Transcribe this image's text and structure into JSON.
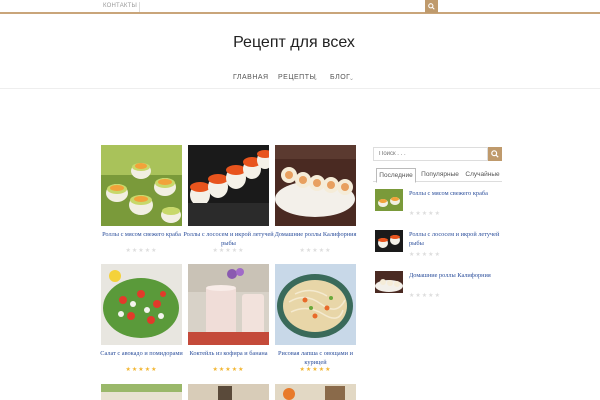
{
  "topbar": {
    "link_label": "Контакты"
  },
  "site": {
    "title": "Рецепт для всех"
  },
  "nav": [
    {
      "label": "Главная"
    },
    {
      "label": "Рецепты"
    },
    {
      "label": "Блог"
    }
  ],
  "posts": [
    {
      "title": "Роллы с мясом свежего краба",
      "rating": 0,
      "image": "rolls-avocado"
    },
    {
      "title": "Роллы с лососем и икрой летучей рыбы",
      "rating": 0,
      "image": "rolls-salmon-roe"
    },
    {
      "title": "Домашние роллы Калифорния",
      "rating": 0,
      "image": "rolls-california"
    },
    {
      "title": "Салат с авокадо и помидорами",
      "rating": 5,
      "image": "salad-avocado-tomato"
    },
    {
      "title": "Коктейль из кофира и банана",
      "rating": 5,
      "image": "kefir-banana-shake"
    },
    {
      "title": "Рисовая лапша с овощами и курицей",
      "rating": 5,
      "image": "rice-noodles-chicken"
    }
  ],
  "sidebar": {
    "search_placeholder": "Поиск . . .",
    "tabs": [
      {
        "label": "Последние",
        "active": true
      },
      {
        "label": "Популярные",
        "active": false
      },
      {
        "label": "Случайные",
        "active": false
      }
    ],
    "items": [
      {
        "title": "Роллы с мясом свежего краба",
        "rating": 0
      },
      {
        "title": "Роллы с лососем и икрой летучей рыбы",
        "rating": 0
      },
      {
        "title": "Домашние роллы Калифорния",
        "rating": 0
      }
    ]
  },
  "colors": {
    "accent": "#bf9a6c",
    "link": "#2b4e9b",
    "star_filled": "#f2b632",
    "star_empty": "#dddddd"
  }
}
